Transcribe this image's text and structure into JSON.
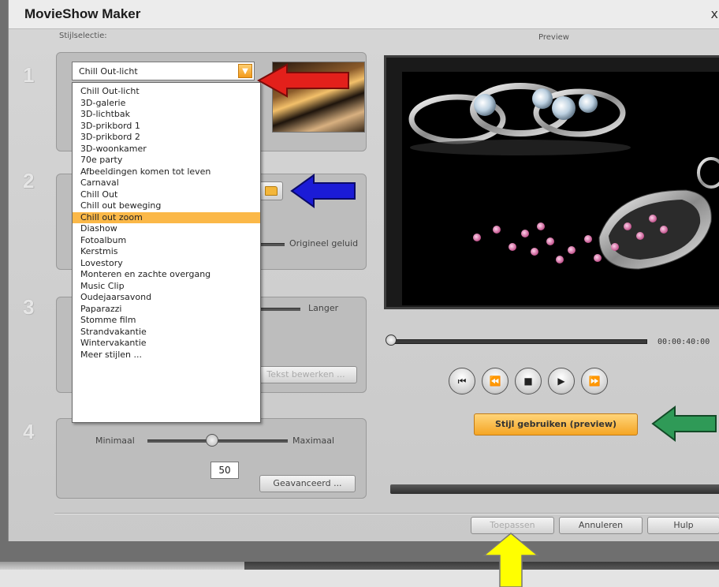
{
  "window": {
    "title": "MovieShow Maker",
    "close_label": "x"
  },
  "labels": {
    "style_selection": "Stijlselectie:",
    "preview": "Preview"
  },
  "steps": [
    "1",
    "2",
    "3",
    "4"
  ],
  "style_combo": {
    "value": "Chill Out-licht"
  },
  "style_list": {
    "items": [
      "Chill Out-licht",
      "3D-galerie",
      "3D-lichtbak",
      "3D-prikbord 1",
      "3D-prikbord 2",
      "3D-woonkamer",
      "70e party",
      "Afbeeldingen komen tot leven",
      "Carnaval",
      "Chill Out",
      "Chill out beweging",
      "Chill out zoom",
      "Diashow",
      "Fotoalbum",
      "Kerstmis",
      "Lovestory",
      "Monteren en zachte overgang",
      "Music Clip",
      "Oudejaarsavond",
      "Paparazzi",
      "Stomme film",
      "Strandvakantie",
      "Wintervakantie",
      "Meer stijlen ..."
    ],
    "selected_index": 11
  },
  "audio": {
    "original_sound_label": "Origineel geluid"
  },
  "duration": {
    "longer_label": "Langer",
    "edit_text_button": "Tekst bewerken ..."
  },
  "effect": {
    "min_label": "Minimaal",
    "max_label": "Maximaal",
    "value": "50",
    "advanced_button": "Geavanceerd ..."
  },
  "player": {
    "timecode": "00:00:40:00",
    "apply_style_button": "Stijl gebruiken (preview)"
  },
  "footer": {
    "apply_button": "Toepassen",
    "cancel_button": "Annuleren",
    "help_button": "Hulp"
  },
  "arrows": {
    "red": "#e3201b",
    "blue": "#1b1bd6",
    "green": "#2f9a57",
    "yellow": "#ffff00"
  }
}
